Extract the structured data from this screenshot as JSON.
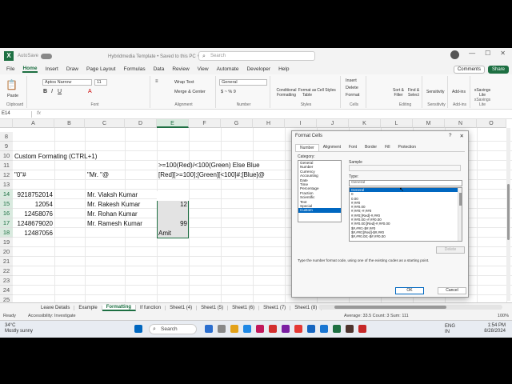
{
  "titlebar": {
    "autosave": "AutoSave",
    "doc_title": "Hybridmedia Template • Saved to this PC ∨",
    "search_placeholder": "Search"
  },
  "menu": [
    "File",
    "Home",
    "Insert",
    "Draw",
    "Page Layout",
    "Formulas",
    "Data",
    "Review",
    "View",
    "Automate",
    "Developer",
    "Help"
  ],
  "menu_active": "Home",
  "menu_right": {
    "comments": "Comments",
    "share": "Share"
  },
  "ribbon": {
    "clipboard": {
      "paste": "Paste",
      "label": "Clipboard"
    },
    "font": {
      "name": "Aptos Narrow",
      "size": "11",
      "label": "Font"
    },
    "alignment": {
      "wrap": "Wrap Text",
      "merge": "Merge & Center",
      "label": "Alignment"
    },
    "number": {
      "format": "General",
      "label": "Number"
    },
    "styles": {
      "conditional": "Conditional Formatting",
      "table": "Format as Table",
      "cell": "Cell Styles",
      "label": "Styles"
    },
    "cells": {
      "insert": "Insert",
      "delete": "Delete",
      "format": "Format",
      "label": "Cells"
    },
    "editing": {
      "sort": "Sort & Filter",
      "find": "Find & Select",
      "label": "Editing"
    },
    "sensitivity": {
      "btn": "Sensitivity",
      "label": "Sensitivity"
    },
    "addins": {
      "btn": "Add-ins",
      "label": "Add-ins"
    },
    "savings": {
      "btn": "xSavings Lite",
      "label": "xSavings Lite"
    }
  },
  "formula_bar": {
    "name_box": "E14",
    "fx": "fx"
  },
  "columns": [
    "A",
    "B",
    "C",
    "D",
    "E",
    "F",
    "G",
    "H",
    "I",
    "J",
    "K",
    "L",
    "M",
    "N",
    "O"
  ],
  "rows": [
    "8",
    "9",
    "10",
    "11",
    "12",
    "13",
    "14",
    "15",
    "16",
    "17",
    "18",
    "19",
    "20",
    "21",
    "22",
    "23",
    "24",
    "25",
    "26",
    "27"
  ],
  "cells": {
    "a10": "Custom Formating (CTRL+1)",
    "a12": "\"0\"#",
    "c12": "\"Mr. \"@",
    "e11": ">=100(Red)/<100(Green) Else Blue",
    "e12": "[Red][>=100];[Green][<100]#;[Blue]@",
    "a14": "9218752014",
    "a15": "12054",
    "a16": "12458076",
    "a17": "1248679020",
    "a18": "12487056",
    "c14": "Mr. Viaksh Kumar",
    "c15": "Mr. Rakesh Kumar",
    "c16": "Mr. Rohan Kumar",
    "c17": "Mr. Ramesh Kumar",
    "e15": "12",
    "e17": "99",
    "e18": "Amit"
  },
  "sheets": [
    "Leave Details",
    "Example",
    "Formatting",
    "If function",
    "Sheet1 (4)",
    "Sheet1 (5)",
    "Sheet1 (6)",
    "Sheet1 (7)",
    "Sheet1 (8)"
  ],
  "active_sheet": "Formatting",
  "status": {
    "ready": "Ready",
    "accessibility": "Accessibility: Investigate",
    "aggregates": "Average: 33.5    Count: 3    Sum: 111",
    "zoom": "100%"
  },
  "taskbar": {
    "temp": "34°C",
    "weather": "Mostly sunny",
    "search": "Search",
    "lang1": "ENG",
    "lang2": "IN",
    "time": "1:54 PM",
    "date": "8/28/2024"
  },
  "dialog": {
    "title": "Format Cells",
    "help": "?",
    "close": "✕",
    "tabs": [
      "Number",
      "Alignment",
      "Font",
      "Border",
      "Fill",
      "Protection"
    ],
    "active_tab": "Number",
    "category_label": "Category:",
    "categories": [
      "General",
      "Number",
      "Currency",
      "Accounting",
      "Date",
      "Time",
      "Percentage",
      "Fraction",
      "Scientific",
      "Text",
      "Special",
      "Custom"
    ],
    "selected_category": "Custom",
    "sample_label": "Sample",
    "type_label": "Type:",
    "type_value": "General",
    "formats": [
      "General",
      "0",
      "0.00",
      "#,##0",
      "#,##0.00",
      "#,##0;-#,##0",
      "#,##0;[Red]-#,##0",
      "#,##0.00;-#,##0.00",
      "#,##0.00;[Red]-#,##0.00",
      "$#,##0;-$#,##0",
      "$#,##0;[Red]-$#,##0",
      "$#,##0.00;-$#,##0.00"
    ],
    "selected_format": "General",
    "delete": "Delete",
    "hint": "Type the number format code, using one of the existing codes as a starting point.",
    "ok": "OK",
    "cancel": "Cancel"
  },
  "colors": {
    "accent": "#1d6f42",
    "selection": "#0067c0"
  }
}
